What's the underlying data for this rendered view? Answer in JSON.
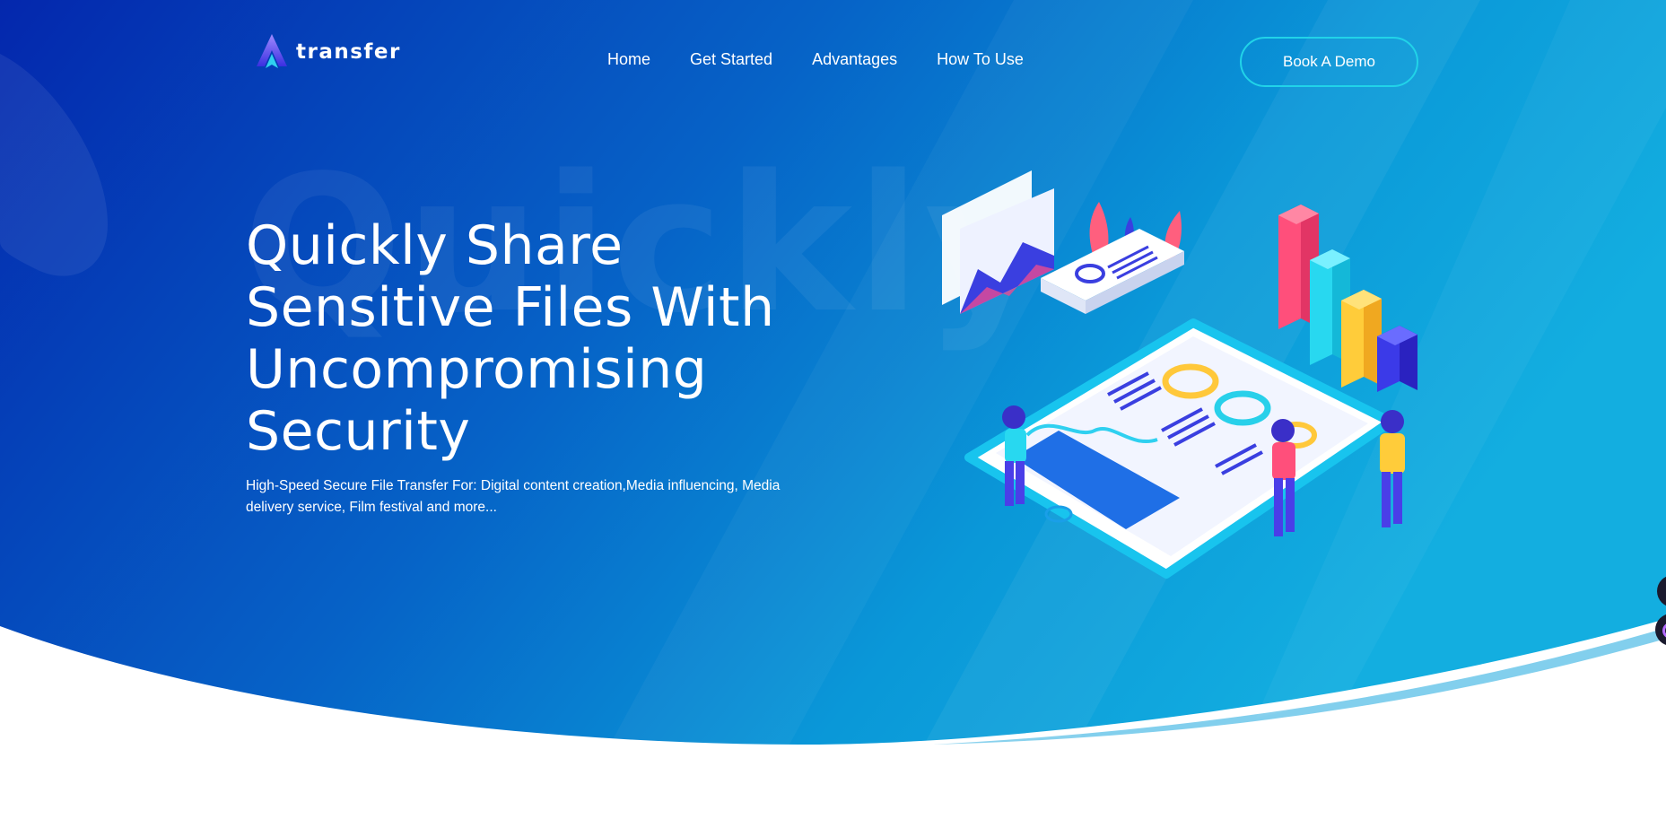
{
  "brand": {
    "name": "transfer",
    "logo_icon": "arrow-a-logo-icon"
  },
  "nav": {
    "items": [
      {
        "label": "Home"
      },
      {
        "label": "Get Started"
      },
      {
        "label": "Advantages"
      },
      {
        "label": "How To Use"
      }
    ],
    "cta_label": "Book A Demo"
  },
  "hero": {
    "watermark": "Quickly",
    "headline": "Quickly Share Sensitive Files With Uncompromising Security",
    "subtitle": "High-Speed Secure File Transfer For: Digital content creation,Media influencing, Media delivery service, Film festival and more...",
    "illustration": "analytics-dashboard-illustration"
  },
  "colors": {
    "bg_dark": "#0430b0",
    "bg_light": "#0aa6dc",
    "cta_border": "#21d3e8",
    "text": "#ffffff"
  }
}
